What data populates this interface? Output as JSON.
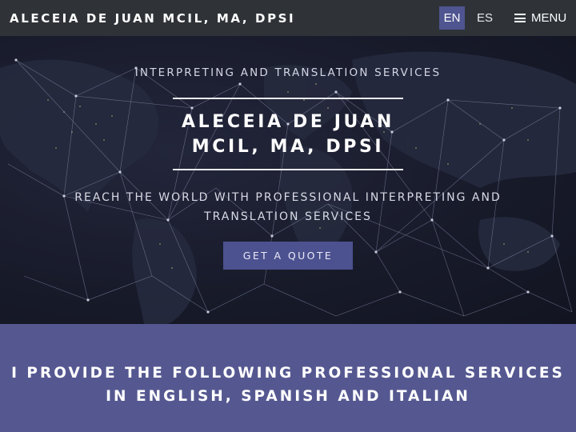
{
  "header": {
    "brand": "ALECEIA DE JUAN MCIL, MA, DPSI",
    "languages": [
      {
        "label": "EN",
        "active": true
      },
      {
        "label": "ES",
        "active": false
      }
    ],
    "menu_label": "MENU",
    "menu_icon": "hamburger-icon"
  },
  "hero": {
    "eyebrow": "INTERPRETING AND TRANSLATION SERVICES",
    "title_line1": "ALECEIA DE JUAN",
    "title_line2": "MCIL, MA, DPSI",
    "tagline_line1": "REACH THE WORLD WITH PROFESSIONAL INTERPRETING AND",
    "tagline_line2": "TRANSLATION SERVICES",
    "cta_label": "GET A QUOTE",
    "background": "world-map-network-image"
  },
  "services": {
    "heading_line1": "I PROVIDE THE FOLLOWING PROFESSIONAL SERVICES",
    "heading_line2": "IN ENGLISH, SPANISH AND ITALIAN"
  },
  "colors": {
    "header_bg": "#2f3338",
    "accent": "#4e5590",
    "services_bg": "#555890",
    "hero_bg": "#171a29"
  }
}
